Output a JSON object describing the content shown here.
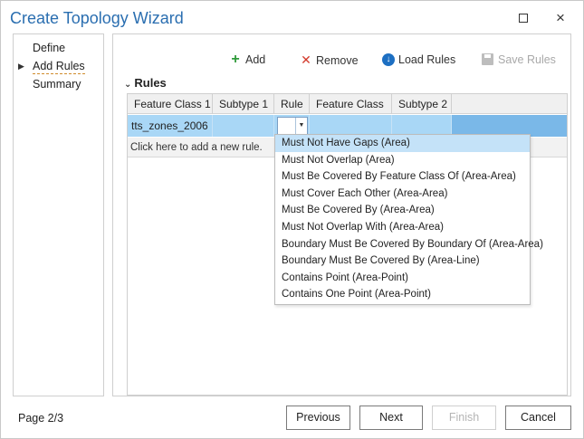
{
  "window": {
    "title": "Create Topology Wizard",
    "maximize_label": "",
    "close_label": "×"
  },
  "nav": {
    "items": [
      {
        "label": "Define"
      },
      {
        "label": "Add Rules",
        "current": true
      },
      {
        "label": "Summary"
      }
    ]
  },
  "toolbar": {
    "add_label": "Add",
    "remove_label": "Remove",
    "load_label": "Load Rules",
    "save_label": "Save Rules",
    "save_enabled": false
  },
  "section": {
    "title": "Rules"
  },
  "grid": {
    "columns": [
      "Feature Class 1",
      "Subtype 1",
      "Rule",
      "Feature Class 2",
      "Subtype 2"
    ],
    "rows": [
      {
        "feature_class_1": "tts_zones_2006",
        "subtype_1": "",
        "rule": "",
        "feature_class_2": "",
        "subtype_2": ""
      }
    ],
    "add_row_hint": "Click here to add a new rule."
  },
  "rule_dropdown": {
    "selected_index": 0,
    "options": [
      "Must Not Have Gaps (Area)",
      "Must Not Overlap (Area)",
      "Must Be Covered By Feature Class Of (Area-Area)",
      "Must Cover Each Other (Area-Area)",
      "Must Be Covered By (Area-Area)",
      "Must Not Overlap With (Area-Area)",
      "Boundary Must Be Covered By Boundary Of (Area-Area)",
      "Boundary Must Be Covered By (Area-Line)",
      "Contains Point (Area-Point)",
      "Contains One Point (Area-Point)"
    ]
  },
  "footer": {
    "page_label": "Page 2/3",
    "previous_label": "Previous",
    "next_label": "Next",
    "finish_label": "Finish",
    "finish_enabled": false,
    "cancel_label": "Cancel"
  },
  "colors": {
    "title": "#2a6eb0",
    "selected_row": "#a9d7f6",
    "selected_row_tail": "#7ab8e8",
    "dropdown_highlight": "#c4e2f8",
    "add_icon": "#2e9a3a",
    "remove_icon": "#d33a2c",
    "load_icon": "#1d6fc2"
  },
  "icons": {
    "add": "plus-icon",
    "remove": "x-icon",
    "load": "download-circle-icon",
    "save": "save-disk-icon",
    "nav_current": "triangle-right-icon",
    "section": "chevron-down-icon",
    "combo": "dropdown-arrow-icon"
  }
}
